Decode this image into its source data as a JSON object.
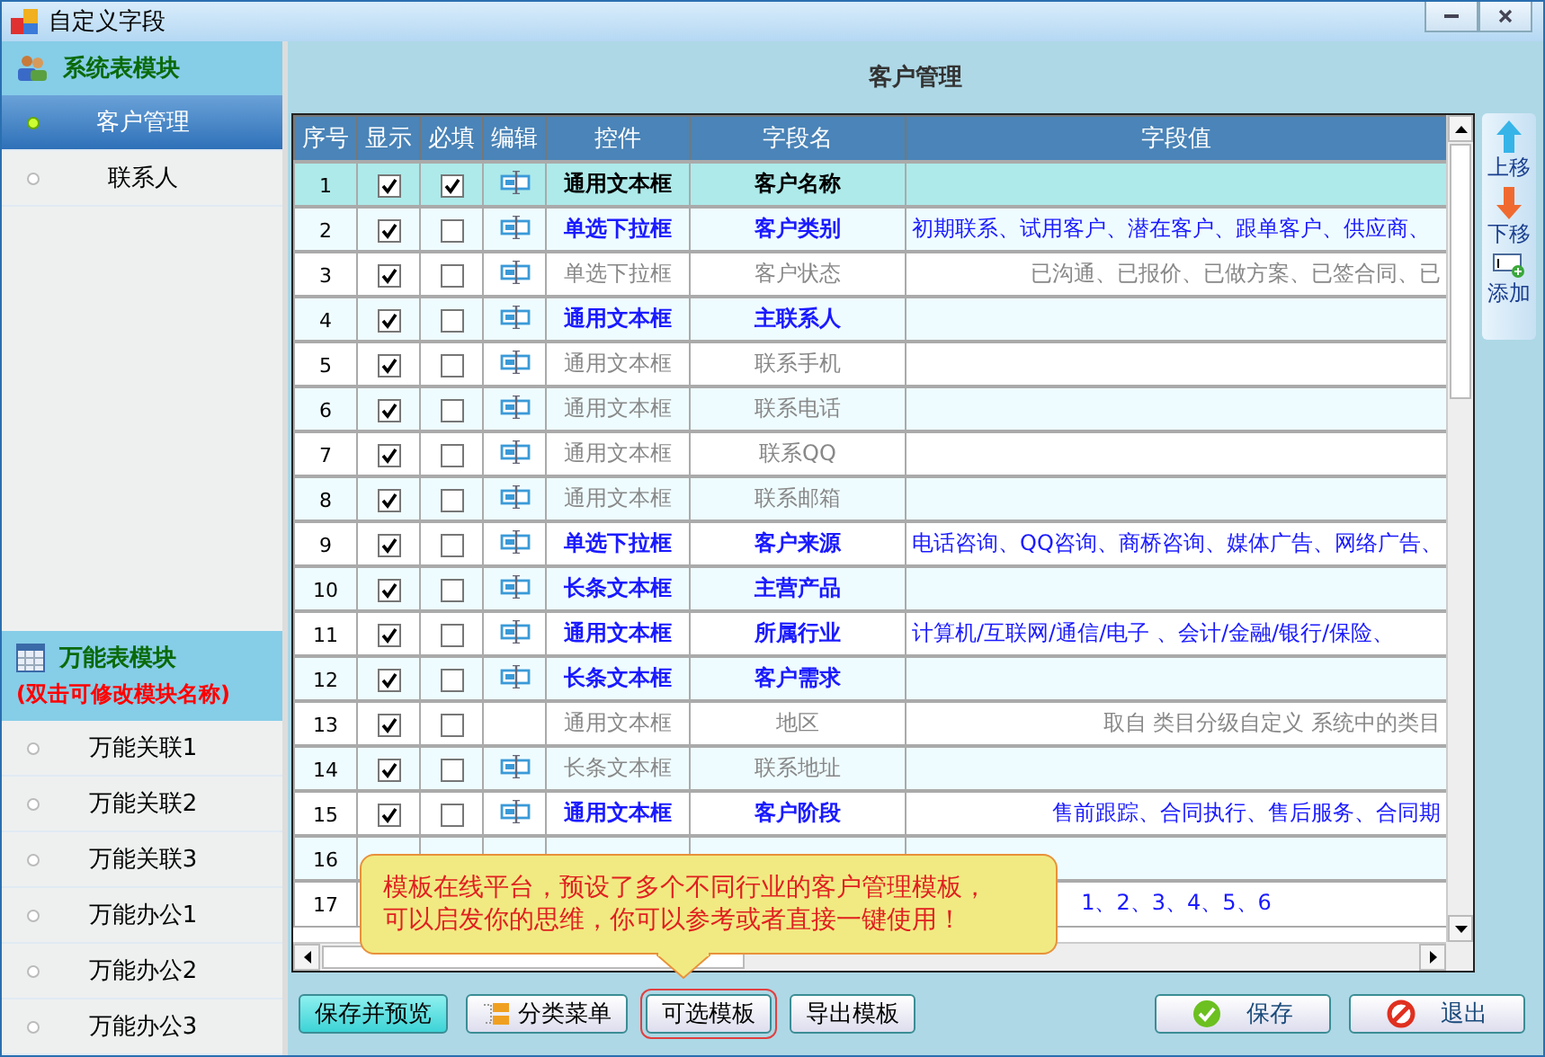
{
  "window": {
    "title": "自定义字段"
  },
  "sidebar": {
    "sections": [
      {
        "kind": "system",
        "title": "系统表模块",
        "items": [
          {
            "label": "客户管理",
            "selected": true
          },
          {
            "label": "联系人",
            "selected": false
          }
        ]
      },
      {
        "kind": "universal",
        "title": "万能表模块",
        "subtitle": "(双击可修改模块名称)",
        "items": [
          {
            "label": "万能关联1",
            "selected": false
          },
          {
            "label": "万能关联2",
            "selected": false
          },
          {
            "label": "万能关联3",
            "selected": false
          },
          {
            "label": "万能办公1",
            "selected": false
          },
          {
            "label": "万能办公2",
            "selected": false
          },
          {
            "label": "万能办公3",
            "selected": false
          }
        ]
      }
    ]
  },
  "panel_title": "客户管理",
  "table": {
    "columns": [
      "序号",
      "显示",
      "必填",
      "编辑",
      "控件",
      "字段名",
      "字段值"
    ],
    "rows": [
      {
        "no": "1",
        "show": true,
        "required": true,
        "editable": true,
        "control": "通用文本框",
        "field": "客户名称",
        "disabled": false,
        "selected": true
      },
      {
        "no": "2",
        "show": true,
        "required": false,
        "editable": true,
        "control": "单选下拉框",
        "field": "客户类别",
        "value": "初期联系、试用客户、潜在客户、跟单客户、供应商、",
        "disabled": false,
        "selected": false
      },
      {
        "no": "3",
        "show": true,
        "required": false,
        "editable": true,
        "control": "单选下拉框",
        "field": "客户状态",
        "value": "已沟通、已报价、已做方案、已签合同、已",
        "disabled": true,
        "selected": false,
        "kind": "right"
      },
      {
        "no": "4",
        "show": true,
        "required": false,
        "editable": true,
        "control": "通用文本框",
        "field": "主联系人",
        "disabled": false,
        "selected": false
      },
      {
        "no": "5",
        "show": true,
        "required": false,
        "editable": true,
        "control": "通用文本框",
        "field": "联系手机",
        "disabled": true,
        "selected": false
      },
      {
        "no": "6",
        "show": true,
        "required": false,
        "editable": true,
        "control": "通用文本框",
        "field": "联系电话",
        "disabled": true,
        "selected": false
      },
      {
        "no": "7",
        "show": true,
        "required": false,
        "editable": true,
        "control": "通用文本框",
        "field": "联系QQ",
        "disabled": true,
        "selected": false
      },
      {
        "no": "8",
        "show": true,
        "required": false,
        "editable": true,
        "control": "通用文本框",
        "field": "联系邮箱",
        "disabled": true,
        "selected": false
      },
      {
        "no": "9",
        "show": true,
        "required": false,
        "editable": true,
        "control": "单选下拉框",
        "field": "客户来源",
        "value": "电话咨询、QQ咨询、商桥咨询、媒体广告、网络广告、",
        "disabled": false,
        "selected": false
      },
      {
        "no": "10",
        "show": true,
        "required": false,
        "editable": true,
        "control": "长条文本框",
        "field": "主营产品",
        "disabled": false,
        "selected": false
      },
      {
        "no": "11",
        "show": true,
        "required": false,
        "editable": true,
        "control": "通用文本框",
        "field": "所属行业",
        "value": "计算机/互联网/通信/电子 、会计/金融/银行/保险、",
        "disabled": false,
        "selected": false
      },
      {
        "no": "12",
        "show": true,
        "required": false,
        "editable": true,
        "control": "长条文本框",
        "field": "客户需求",
        "disabled": false,
        "selected": false
      },
      {
        "no": "13",
        "show": true,
        "required": false,
        "editable": false,
        "control": "通用文本框",
        "field": "地区",
        "value": "取自 类目分级自定义 系统中的类目",
        "disabled": true,
        "selected": false,
        "kind": "right"
      },
      {
        "no": "14",
        "show": true,
        "required": false,
        "editable": true,
        "control": "长条文本框",
        "field": "联系地址",
        "disabled": true,
        "selected": false
      },
      {
        "no": "15",
        "show": true,
        "required": false,
        "editable": true,
        "control": "通用文本框",
        "field": "客户阶段",
        "value": "售前跟踪、合同执行、售后服务、合同期",
        "disabled": false,
        "selected": false,
        "kind": "right"
      },
      {
        "no": "16",
        "selected": false
      },
      {
        "no": "17",
        "value": "1、2、3、4、5、6",
        "disabled": false,
        "selected": false,
        "kind": "centered"
      }
    ]
  },
  "side_tools": [
    "上移",
    "下移",
    "添加"
  ],
  "callout": "模板在线平台，预设了多个不同行业的客户管理模板，可以启发你的思维，你可以参考或者直接一键使用！",
  "buttons": [
    {
      "label": "保存并预览",
      "kind": "primary"
    },
    {
      "label": "分类菜单",
      "kind": "folder"
    },
    {
      "label": "可选模板",
      "kind": "highlighted"
    },
    {
      "label": "导出模板",
      "kind": "plain"
    }
  ],
  "actions": [
    {
      "label": "保存",
      "kind": "ok"
    },
    {
      "label": "退出",
      "kind": "cancel"
    }
  ]
}
